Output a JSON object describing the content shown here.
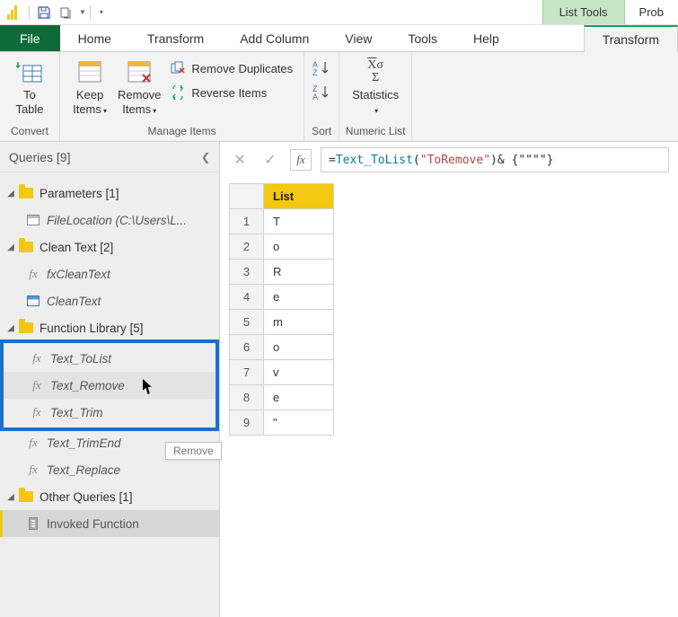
{
  "titlebar": {
    "context_tab_group": "List Tools",
    "title_tail": "Prob"
  },
  "tabs": {
    "file": "File",
    "home": "Home",
    "transform": "Transform",
    "addcolumn": "Add Column",
    "view": "View",
    "tools": "Tools",
    "help": "Help",
    "active": "Transform"
  },
  "ribbon": {
    "convert": {
      "label": "Convert",
      "to_table": "To\nTable"
    },
    "manage": {
      "label": "Manage Items",
      "keep": "Keep\nItems",
      "remove": "Remove\nItems",
      "remove_dup": "Remove Duplicates",
      "reverse": "Reverse Items"
    },
    "sort": {
      "label": "Sort"
    },
    "numeric": {
      "label": "Numeric List",
      "stats": "Statistics"
    }
  },
  "queries": {
    "header": "Queries [9]",
    "groups": [
      {
        "label": "Parameters [1]",
        "items": [
          {
            "label": "FileLocation (C:\\Users\\L...",
            "icon": "param",
            "italic": true
          }
        ]
      },
      {
        "label": "Clean Text [2]",
        "items": [
          {
            "label": "fxCleanText",
            "icon": "fx",
            "italic": true
          },
          {
            "label": "CleanText",
            "icon": "table",
            "italic": true
          }
        ]
      },
      {
        "label": "Function Library [5]",
        "items": [
          {
            "label": "Text_ToList",
            "icon": "fx",
            "italic": true
          },
          {
            "label": "Text_Remove",
            "icon": "fx",
            "italic": true
          },
          {
            "label": "Text_Trim",
            "icon": "fx",
            "italic": true
          },
          {
            "label": "Text_TrimEnd",
            "icon": "fx",
            "italic": true
          },
          {
            "label": "Text_Replace",
            "icon": "fx",
            "italic": true
          }
        ]
      },
      {
        "label": "Other Queries [1]",
        "items": [
          {
            "label": "Invoked Function",
            "icon": "list",
            "italic": false,
            "selected": true
          }
        ]
      }
    ],
    "tooltip": "Remove"
  },
  "formula": {
    "text_pre": "= ",
    "fn": "Text_ToList",
    "paren_open": "(",
    "arg_str": "\"ToRemove\"",
    "paren_close": ")",
    "rest": " & {\"\"\"\"}"
  },
  "grid": {
    "header": "List",
    "rows": [
      "T",
      "o",
      "R",
      "e",
      "m",
      "o",
      "v",
      "e",
      "\""
    ]
  }
}
